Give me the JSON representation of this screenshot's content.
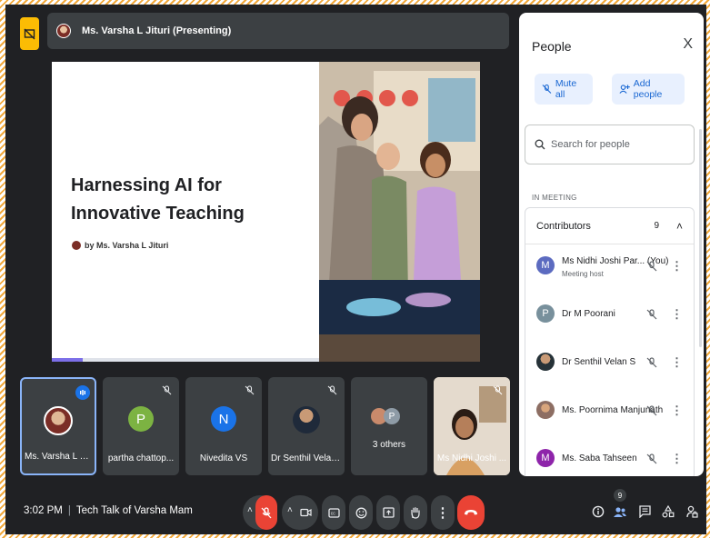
{
  "presenter_bar": {
    "name": "Ms. Varsha L Jituri (Presenting)"
  },
  "slide": {
    "title": "Harnessing AI for Innovative Teaching",
    "byline": "by Ms. Varsha L Jituri"
  },
  "tiles": [
    {
      "label": "Ms. Varsha L Jit...",
      "initial": "",
      "color": "#5f6368"
    },
    {
      "label": "partha chattop...",
      "initial": "P",
      "color": "#7cb342"
    },
    {
      "label": "Nivedita VS",
      "initial": "N",
      "color": "#1a73e8"
    },
    {
      "label": "Dr Senthil Velan S",
      "initial": "",
      "color": "#5f6368"
    },
    {
      "label": "3 others",
      "initial": "P",
      "color": "#8e9ba6"
    },
    {
      "label": "Ms Nidhi Joshi ...",
      "initial": "",
      "color": "#5f6368"
    }
  ],
  "bottom": {
    "time": "3:02 PM",
    "meeting_title": "Tech Talk of Varsha Mam",
    "people_count": "9"
  },
  "panel": {
    "title": "People",
    "close": "X",
    "mute_all": "Mute all",
    "add_people": "Add people",
    "search_placeholder": "Search for people",
    "section": "IN MEETING",
    "contributors_label": "Contributors",
    "contributors_count": "9",
    "participants": [
      {
        "name": "Ms Nidhi Joshi Par... (You)",
        "sub": "Meeting host",
        "initial": "M",
        "color": "#5c6bc0"
      },
      {
        "name": "Dr M Poorani",
        "sub": "",
        "initial": "P",
        "color": "#78909c"
      },
      {
        "name": "Dr Senthil Velan S",
        "sub": "",
        "initial": "",
        "color": "#37474f"
      },
      {
        "name": "Ms. Poornima Manjunath",
        "sub": "",
        "initial": "",
        "color": "#8d6e63"
      },
      {
        "name": "Ms. Saba Tahseen",
        "sub": "",
        "initial": "M",
        "color": "#8e24aa"
      }
    ]
  }
}
